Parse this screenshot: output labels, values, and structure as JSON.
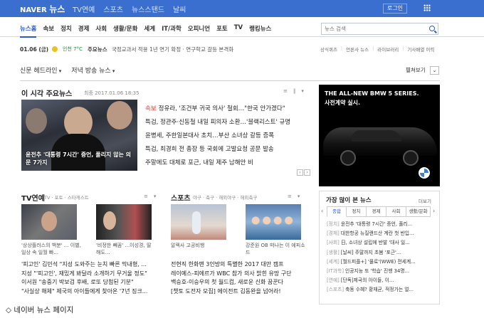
{
  "header": {
    "logo": "NAVER",
    "logo_news": "뉴스",
    "nav": [
      "TV연예",
      "스포츠",
      "뉴스스탠드",
      "날씨"
    ],
    "login": "로그인"
  },
  "categories": [
    "뉴스홈",
    "속보",
    "정치",
    "경제",
    "사회",
    "생활/문화",
    "세계",
    "IT/과학",
    "오피니언",
    "포토",
    "TV",
    "랭킹뉴스"
  ],
  "search": {
    "placeholder": "뉴스 검색"
  },
  "info": {
    "date": "01.06 (금)",
    "weather": "인천 7°C",
    "ticker_label": "주요뉴스",
    "ticker": "국정교과서 적용 1년 연기 확정 · 연구학교 갈등 본격화",
    "links": [
      "상식퀴즈",
      "언론사 뉴스",
      "라이브러리",
      "기사배열 이력"
    ]
  },
  "selectors": [
    "신문 헤드라인",
    "저녁 방송 뉴스"
  ],
  "view_label": "펼쳐보기",
  "main": {
    "title": "이 시각 주요뉴스",
    "time": "최종 2017.01.06 18:35",
    "photo_caption": "윤전추 '대통령 7시간' 증언, 풀리지 않는 의문 7가지",
    "headlines": [
      {
        "tag": "속보",
        "text": "정유라, '조건부 귀국 의사' 철회…\"한국 안가겠다\""
      },
      {
        "tag": "",
        "text": "특검, 정관주·신동철 내일 피의자 소환…'블랙리스트' 규명"
      },
      {
        "tag": "",
        "text": "윤병세, 주한일본대사 초치…부산 소녀상 갈등 증폭"
      },
      {
        "tag": "",
        "text": "특검, 최경희 전 총장 등 국회에 고발요청 공문 발송"
      },
      {
        "tag": "",
        "text": "주말에도 대체로 포근, 내일 제주 남해안 비"
      }
    ]
  },
  "ad": {
    "line1": "THE ALL-NEW BMW 5 SERIES.",
    "line2": "사전계약 실시."
  },
  "tv": {
    "title": "TV연예",
    "sub": "TV · 포토 · 스타캐스트",
    "captions": [
      "'상상플러스의 백분' ... 이별, 일상 속 일월 빠...",
      "'비정한 빼꼼' ...이성경, 딸 해도..."
    ],
    "list": [
      "'피고인' 김민석 \"지성 도와주는 눈치 빠른 막내형, ...",
      "지성 \"'피고인', 재밌게 봐달라 소개하기 무거울 정도\"",
      "이서원 \"송중기 박보검 후배, 로또 당첨된 기분\"",
      "\"사실상 해체\" 제국의 아이들에게 찾아온 '7년 징크..."
    ]
  },
  "sports": {
    "title": "스포츠",
    "sub": "야구 · 축구 · 해외야구 · 해외축구",
    "captions": [
      "알렉사 고공비행",
      "강준원 OB 떠나는 이 에피소드"
    ],
    "list": [
      "전현직 한화맨 3인방의 특별한 2017 대만 캠프",
      "레이예스-피에르가 WBC 참가 의사 밝힌 유망 구단",
      "백승호-이승우의 첫 월드컵, 새로운 신화 꿈꾼다",
      "[챗토 도전자 모집] 에이전트 김동완을 넘어라!"
    ]
  },
  "popular": {
    "title": "가장 많이 본 뉴스",
    "more": "더보기",
    "tabs": [
      "종합",
      "정치",
      "경제",
      "사회",
      "생활/문화"
    ],
    "items": [
      {
        "cat": "[정치]",
        "text": "윤전추 '대통령 7시간' 증언, 풀리..."
      },
      {
        "cat": "[경제]",
        "text": "대한항공 뉴질랜드산 계란 첫 반입..."
      },
      {
        "cat": "[사회]",
        "text": "日, 소녀상 설립에 반발 '대사 일..."
      },
      {
        "cat": "[생활]",
        "text": "[날씨] 주말까지 초봄 '포근'..."
      },
      {
        "cat": "[세계]",
        "text": "[월드피플+] '물로'(WWE) 전세계..."
      },
      {
        "cat": "[IT과학]",
        "text": "인공지능 또 '학습' 진행 34명..."
      },
      {
        "cat": "[연예]",
        "text": "[단독]제국의 아이들, 이..."
      },
      {
        "cat": "[스포츠]",
        "text": "축동 수혜? 황재균, 적정가는 얼..."
      }
    ]
  },
  "caption": "◇ 네이버 뉴스 페이지"
}
